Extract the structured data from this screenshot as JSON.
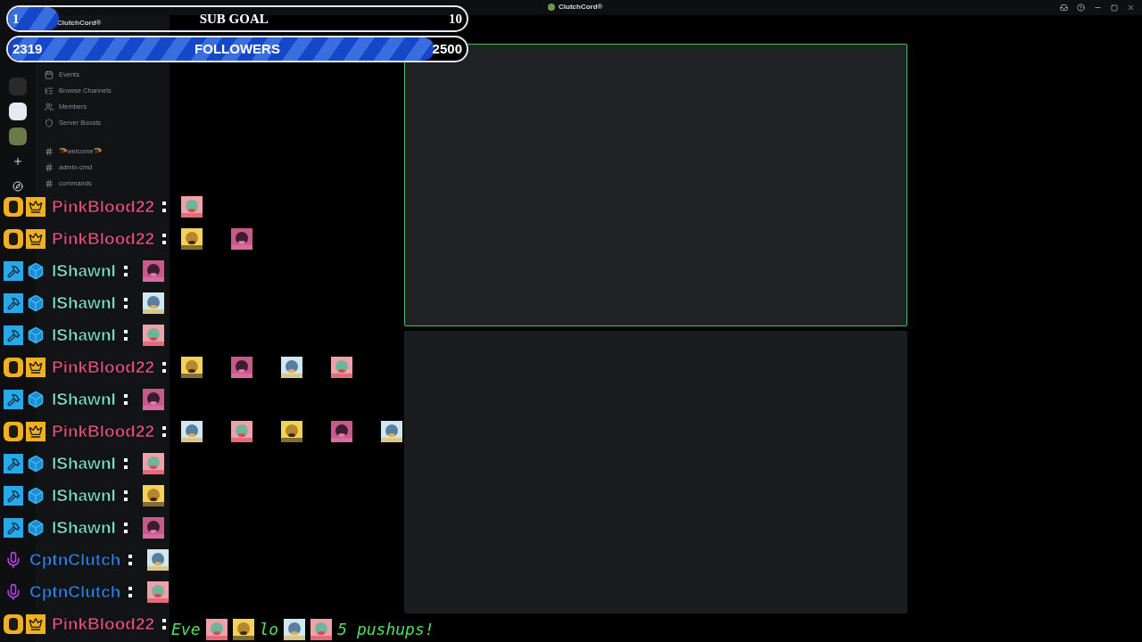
{
  "window": {
    "title": "ClutchCord®"
  },
  "server": {
    "name": "ClutchCord®"
  },
  "sidebar": {
    "items": [
      {
        "label": "Events",
        "kind": "menu"
      },
      {
        "label": "Browse Channels",
        "kind": "menu"
      },
      {
        "label": "Members",
        "kind": "menu"
      },
      {
        "label": "Server Boosts",
        "kind": "menu"
      },
      {
        "label": "🪂welcome🪂",
        "kind": "channel"
      },
      {
        "label": "admin-cmd",
        "kind": "channel"
      },
      {
        "label": "commands",
        "kind": "channel"
      }
    ]
  },
  "goals": [
    {
      "start": "1",
      "label": "SUB GOAL",
      "end": "10",
      "level": 0.11,
      "kind": "serif"
    },
    {
      "start": "2319",
      "label": "FOLLOWERS",
      "end": "2500",
      "level": 0.93,
      "kind": "sans"
    }
  ],
  "chat": [
    {
      "badges": [
        {
          "kind": "sub"
        },
        {
          "kind": "crown"
        }
      ],
      "name": "PinkBlood22",
      "color": "#e0527e",
      "emotes": [
        {
          "kind": "picture"
        }
      ]
    },
    {
      "badges": [
        {
          "kind": "sub"
        },
        {
          "kind": "crown"
        }
      ],
      "name": "PinkBlood22",
      "color": "#e0527e",
      "emotes": [
        {
          "kind": "picture"
        },
        {
          "kind": "picture"
        }
      ]
    },
    {
      "badges": [
        {
          "kind": "mod"
        },
        {
          "kind": "cube"
        }
      ],
      "name": "IShawnl",
      "color": "#7fe3c4",
      "emotes": [
        {
          "kind": "picture"
        }
      ]
    },
    {
      "badges": [
        {
          "kind": "mod"
        },
        {
          "kind": "cube"
        }
      ],
      "name": "IShawnl",
      "color": "#7fe3c4",
      "emotes": [
        {
          "kind": "picture"
        }
      ]
    },
    {
      "badges": [
        {
          "kind": "mod"
        },
        {
          "kind": "cube"
        }
      ],
      "name": "IShawnl",
      "color": "#7fe3c4",
      "emotes": [
        {
          "kind": "picture"
        }
      ]
    },
    {
      "badges": [
        {
          "kind": "sub"
        },
        {
          "kind": "crown"
        }
      ],
      "name": "PinkBlood22",
      "color": "#e0527e",
      "emotes": [
        {
          "kind": "picture"
        },
        {
          "kind": "picture"
        },
        {
          "kind": "picture"
        },
        {
          "kind": "picture"
        }
      ]
    },
    {
      "badges": [
        {
          "kind": "mod"
        },
        {
          "kind": "cube"
        }
      ],
      "name": "IShawnl",
      "color": "#7fe3c4",
      "emotes": [
        {
          "kind": "picture"
        }
      ]
    },
    {
      "badges": [
        {
          "kind": "sub"
        },
        {
          "kind": "crown"
        }
      ],
      "name": "PinkBlood22",
      "color": "#e0527e",
      "emotes": [
        {
          "kind": "picture"
        },
        {
          "kind": "picture"
        },
        {
          "kind": "picture"
        },
        {
          "kind": "picture"
        },
        {
          "kind": "picture"
        }
      ]
    },
    {
      "badges": [
        {
          "kind": "mod"
        },
        {
          "kind": "cube"
        }
      ],
      "name": "IShawnl",
      "color": "#7fe3c4",
      "emotes": [
        {
          "kind": "picture"
        }
      ]
    },
    {
      "badges": [
        {
          "kind": "mod"
        },
        {
          "kind": "cube"
        }
      ],
      "name": "IShawnl",
      "color": "#7fe3c4",
      "emotes": [
        {
          "kind": "picture"
        }
      ]
    },
    {
      "badges": [
        {
          "kind": "mod"
        },
        {
          "kind": "cube"
        }
      ],
      "name": "IShawnl",
      "color": "#7fe3c4",
      "emotes": [
        {
          "kind": "picture"
        }
      ]
    },
    {
      "badges": [
        {
          "kind": "mic"
        }
      ],
      "name": "CptnClutch",
      "color": "#2f80e4",
      "emotes": [
        {
          "kind": "picture"
        }
      ]
    },
    {
      "badges": [
        {
          "kind": "mic"
        }
      ],
      "name": "CptnClutch",
      "color": "#2f80e4",
      "emotes": [
        {
          "kind": "picture"
        }
      ]
    },
    {
      "badges": [
        {
          "kind": "sub"
        },
        {
          "kind": "crown"
        }
      ],
      "name": "PinkBlood22",
      "color": "#e0527e"
    }
  ],
  "message": {
    "parts": [
      {
        "kind": "text",
        "text": "Eve"
      },
      {
        "kind": "emote"
      },
      {
        "kind": "emote"
      },
      {
        "kind": "text",
        "text": "lo"
      },
      {
        "kind": "emote"
      },
      {
        "kind": "emote"
      },
      {
        "kind": "text",
        "text": "5 pushups!"
      }
    ]
  },
  "cameras": [
    {
      "active": true
    },
    {
      "active": false
    }
  ]
}
